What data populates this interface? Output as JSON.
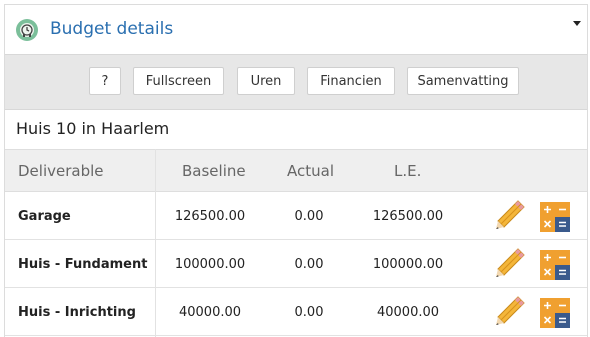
{
  "header": {
    "title": "Budget details"
  },
  "toolbar": {
    "help_label": "?",
    "fullscreen_label": "Fullscreen",
    "uren_label": "Uren",
    "financien_label": "Financien",
    "samenvatting_label": "Samenvatting"
  },
  "project": {
    "name": "Huis 10 in Haarlem"
  },
  "table": {
    "columns": {
      "deliverable": "Deliverable",
      "baseline": "Baseline",
      "actual": "Actual",
      "le": "L.E."
    },
    "rows": [
      {
        "name": "Garage",
        "baseline": "126500.00",
        "actual": "0.00",
        "le": "126500.00"
      },
      {
        "name": "Huis - Fundament",
        "baseline": "100000.00",
        "actual": "0.00",
        "le": "100000.00"
      },
      {
        "name": "Huis - Inrichting",
        "baseline": "40000.00",
        "actual": "0.00",
        "le": "40000.00"
      }
    ]
  },
  "colors": {
    "title": "#2a6fb0",
    "calc_orange": "#f0a030",
    "calc_blue": "#3a5a8c"
  },
  "icons": {
    "logo": "clock-badge-icon",
    "edit": "pencil-icon",
    "calc": "calculator-icon",
    "menu": "caret-down-icon"
  }
}
